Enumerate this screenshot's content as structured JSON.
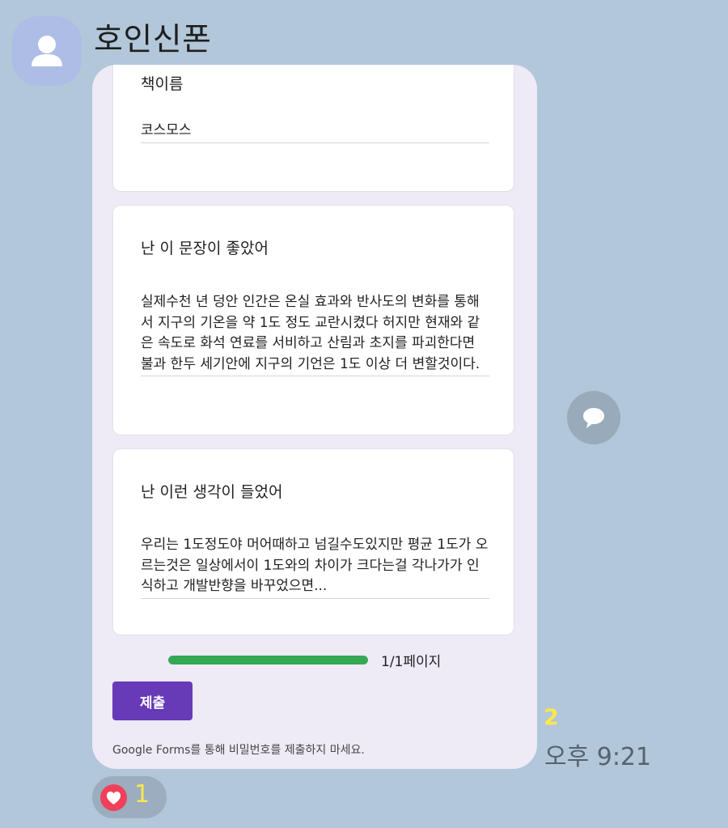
{
  "chat": {
    "sender_name": "호인신폰",
    "avatar_icon": "person-icon",
    "time": "오후 9:21",
    "unread_count": "2",
    "reaction": {
      "icon": "heart-icon",
      "count": "1"
    },
    "share_icon": "speech-bubble-icon"
  },
  "form": {
    "questions": [
      {
        "title": "책이름",
        "answer": "코스모스"
      },
      {
        "title": "난 이 문장이 좋았어",
        "answer": "실제수천 년 덩안 인간은 온실 효과와 반사도의 변화를 통해서 지구의 기온을 약 1도 정도 교란시켰다 허지만 현재와 같은 속도로 화석 연료를 서비하고 산림과 초지를 파괴한다면 불과 한두 세기안에 지구의 기언은 1도 이상 더 변할것이다."
      },
      {
        "title": "난 이런  생각이 들었어",
        "answer": "우리는 1도정도야 머어때하고 넘길수도있지만 평균 1도가 오르는것은 일상에서이 1도와의 차이가 크다는걸 각나가가 인식하고 개발반향을 바꾸었으면..."
      }
    ],
    "progress": {
      "fraction": 1.0,
      "label": "1/1페이지"
    },
    "submit_label": "제출",
    "notice": "Google Forms를 통해 비밀번호를 제출하지 마세요."
  },
  "colors": {
    "chat_background": "#b2c7d9",
    "bubble_background": "#eeeaf6",
    "submit_button": "#673ab7",
    "progress_fill": "#34a853",
    "unread_badge": "#fbe74d",
    "heart": "#f0405a"
  }
}
